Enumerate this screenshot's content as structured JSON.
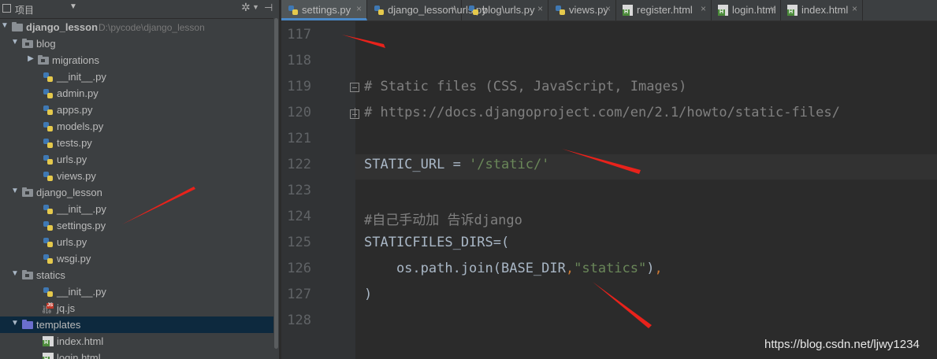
{
  "project_panel": {
    "title": "项目",
    "tree": [
      {
        "label": "django_lesson",
        "path": "D:\\pycode\\django_lesson",
        "kind": "root",
        "level": 0,
        "expanded": true
      },
      {
        "label": "blog",
        "kind": "package",
        "level": 1,
        "expanded": true
      },
      {
        "label": "migrations",
        "kind": "package",
        "level": 2,
        "expanded": false
      },
      {
        "label": "__init__.py",
        "kind": "py",
        "level": 2
      },
      {
        "label": "admin.py",
        "kind": "py",
        "level": 2
      },
      {
        "label": "apps.py",
        "kind": "py",
        "level": 2
      },
      {
        "label": "models.py",
        "kind": "py",
        "level": 2
      },
      {
        "label": "tests.py",
        "kind": "py",
        "level": 2
      },
      {
        "label": "urls.py",
        "kind": "py",
        "level": 2
      },
      {
        "label": "views.py",
        "kind": "py",
        "level": 2
      },
      {
        "label": "django_lesson",
        "kind": "package",
        "level": 1,
        "expanded": true
      },
      {
        "label": "__init__.py",
        "kind": "py",
        "level": 2
      },
      {
        "label": "settings.py",
        "kind": "py",
        "level": 2
      },
      {
        "label": "urls.py",
        "kind": "py",
        "level": 2
      },
      {
        "label": "wsgi.py",
        "kind": "py",
        "level": 2
      },
      {
        "label": "statics",
        "kind": "package",
        "level": 1,
        "expanded": true
      },
      {
        "label": "__init__.py",
        "kind": "py",
        "level": 2
      },
      {
        "label": "jq.js",
        "kind": "js",
        "level": 2
      },
      {
        "label": "templates",
        "kind": "templates",
        "level": 1,
        "expanded": true,
        "selected": true
      },
      {
        "label": "index.html",
        "kind": "html",
        "level": 2
      },
      {
        "label": "login.html",
        "kind": "html",
        "level": 2
      }
    ]
  },
  "tabs": [
    {
      "label": "settings.py",
      "kind": "py",
      "active": true
    },
    {
      "label": "django_lesson\\urls.py",
      "kind": "py",
      "active": false
    },
    {
      "label": "blog\\urls.py",
      "kind": "py",
      "active": false
    },
    {
      "label": "views.py",
      "kind": "py",
      "active": false
    },
    {
      "label": "register.html",
      "kind": "html",
      "active": false
    },
    {
      "label": "login.html",
      "kind": "html",
      "active": false
    },
    {
      "label": "index.html",
      "kind": "html",
      "active": false
    }
  ],
  "editor": {
    "lines": [
      {
        "no": "117",
        "text": ""
      },
      {
        "no": "118",
        "text": ""
      },
      {
        "no": "119",
        "text": "# Static files (CSS, JavaScript, Images)"
      },
      {
        "no": "120",
        "text": "# https://docs.djangoproject.com/en/2.1/howto/static-files/"
      },
      {
        "no": "121",
        "text": ""
      },
      {
        "no": "122",
        "text": "STATIC_URL = '/static/'"
      },
      {
        "no": "123",
        "text": ""
      },
      {
        "no": "124",
        "text": "#自己手动加 告诉django"
      },
      {
        "no": "125",
        "text": "STATICFILES_DIRS=("
      },
      {
        "no": "126",
        "text": "    os.path.join(BASE_DIR,\"statics\"),"
      },
      {
        "no": "127",
        "text": ")"
      },
      {
        "no": "128",
        "text": ""
      }
    ]
  },
  "colors": {
    "panel_bg": "#3c3f41",
    "editor_bg": "#2b2b2b",
    "gutter_bg": "#313335",
    "selected_row": "#0d293e",
    "active_tab_underline": "#4a88c7",
    "annotation_arrow": "#e8221b",
    "comment": "#808080",
    "string": "#6a8759",
    "keyword": "#cc7832"
  },
  "watermark": "https://blog.csdn.net/ljwy1234"
}
